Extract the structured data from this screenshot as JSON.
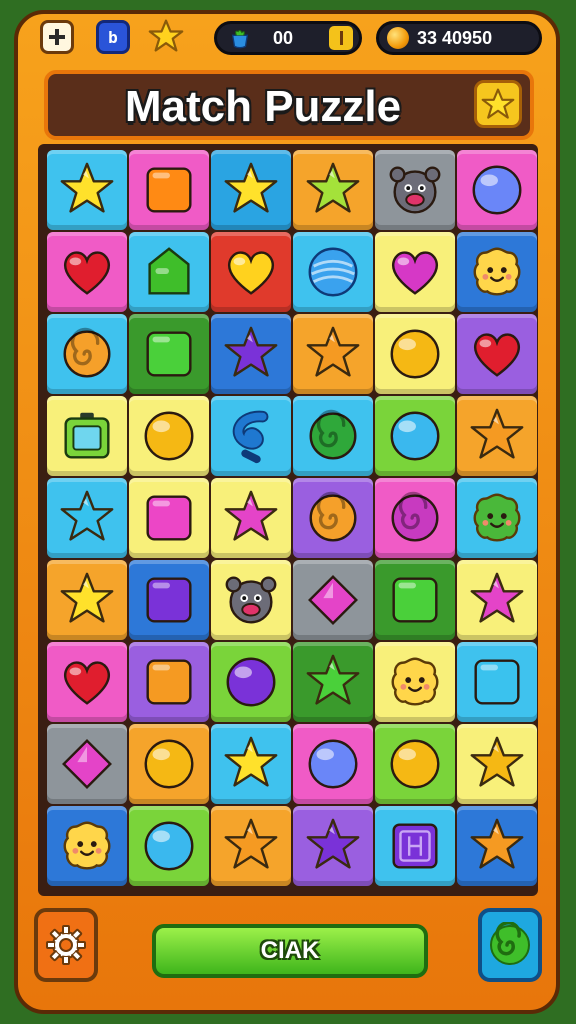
{
  "header": {
    "moves_value": "00",
    "coins_value": "33 40950",
    "blue_button_glyph": "b",
    "icons": [
      "plus-icon",
      "blue-square-icon",
      "star-icon",
      "potion-icon",
      "pause-icon",
      "coin-icon"
    ]
  },
  "title": {
    "text": "Match Puzzle",
    "icon": "star-icon"
  },
  "board": {
    "rows": 9,
    "cols": 6,
    "cells": [
      [
        {
          "bg": "#3fc2ee",
          "piece": "star",
          "color": "#ffe12b"
        },
        {
          "bg": "#f05bc6",
          "piece": "square",
          "color": "#ff8a14"
        },
        {
          "bg": "#2aa4e2",
          "piece": "star",
          "color": "#ffe12b"
        },
        {
          "bg": "#f5a42b",
          "piece": "star",
          "color": "#a4e23a"
        },
        {
          "bg": "#8e959b",
          "piece": "creature",
          "color": "#6c6c78"
        },
        {
          "bg": "#f05bc6",
          "piece": "orb",
          "color": "#6a86f8"
        }
      ],
      [
        {
          "bg": "#f05bc6",
          "piece": "heart",
          "color": "#e01e2e"
        },
        {
          "bg": "#3fc2ee",
          "piece": "gem-house",
          "color": "#3fbe2a"
        },
        {
          "bg": "#e03a2c",
          "piece": "heart",
          "color": "#ffd21e"
        },
        {
          "bg": "#3fc2ee",
          "piece": "swirl-ball",
          "color": "#3aa2ee"
        },
        {
          "bg": "#f8f07a",
          "piece": "heart",
          "color": "#d638c6"
        },
        {
          "bg": "#2d78d8",
          "piece": "blob",
          "color": "#ffd64a"
        }
      ],
      [
        {
          "bg": "#3fc2ee",
          "piece": "spiral",
          "color": "#f5a02a"
        },
        {
          "bg": "#3a9a2c",
          "piece": "square",
          "color": "#4ad03a"
        },
        {
          "bg": "#2d78d8",
          "piece": "star",
          "color": "#7a32d8"
        },
        {
          "bg": "#f5a42b",
          "piece": "star",
          "color": "#f59a22"
        },
        {
          "bg": "#f8f07a",
          "piece": "orb",
          "color": "#f5b814"
        },
        {
          "bg": "#9a5fe0",
          "piece": "heart",
          "color": "#e01e2e"
        }
      ],
      [
        {
          "bg": "#f8f07a",
          "piece": "battery",
          "color": "#7ad43a"
        },
        {
          "bg": "#f8f07a",
          "piece": "orb",
          "color": "#f5b814"
        },
        {
          "bg": "#3fc2ee",
          "piece": "swirl",
          "color": "#1f78d0"
        },
        {
          "bg": "#3fc2ee",
          "piece": "spiral",
          "color": "#2fa83a"
        },
        {
          "bg": "#7ad43a",
          "piece": "orb",
          "color": "#3ab8ee"
        },
        {
          "bg": "#f5a42b",
          "piece": "star",
          "color": "#f59a22"
        }
      ],
      [
        {
          "bg": "#3fc2ee",
          "piece": "star",
          "color": "#36c2ee"
        },
        {
          "bg": "#f8f07a",
          "piece": "square",
          "color": "#ec46c6"
        },
        {
          "bg": "#f8f07a",
          "piece": "star",
          "color": "#e444c8"
        },
        {
          "bg": "#9a5fe0",
          "piece": "spiral",
          "color": "#f5a02a"
        },
        {
          "bg": "#f05bc6",
          "piece": "spiral",
          "color": "#c83ac0"
        },
        {
          "bg": "#3fc2ee",
          "piece": "blob",
          "color": "#4ab83a"
        }
      ],
      [
        {
          "bg": "#f5a42b",
          "piece": "star",
          "color": "#ffe12b"
        },
        {
          "bg": "#2d78d8",
          "piece": "square",
          "color": "#7a32d8"
        },
        {
          "bg": "#f8f07a",
          "piece": "creature",
          "color": "#6c6c78"
        },
        {
          "bg": "#8e959b",
          "piece": "diamond",
          "color": "#e444c8"
        },
        {
          "bg": "#3a9a2c",
          "piece": "square",
          "color": "#4ad03a"
        },
        {
          "bg": "#f8f07a",
          "piece": "star",
          "color": "#e444c8"
        }
      ],
      [
        {
          "bg": "#f05bc6",
          "piece": "heart",
          "color": "#e01e2e"
        },
        {
          "bg": "#9a5fe0",
          "piece": "square",
          "color": "#f59a22"
        },
        {
          "bg": "#7ad43a",
          "piece": "orb",
          "color": "#7a32d8"
        },
        {
          "bg": "#3a9a2c",
          "piece": "star",
          "color": "#4ad03a"
        },
        {
          "bg": "#f8f07a",
          "piece": "blob",
          "color": "#ffd64a"
        },
        {
          "bg": "#3fc2ee",
          "piece": "square",
          "color": "#3ac2ee"
        }
      ],
      [
        {
          "bg": "#8e959b",
          "piece": "diamond",
          "color": "#e444c8"
        },
        {
          "bg": "#f5a42b",
          "piece": "orb",
          "color": "#f5b814"
        },
        {
          "bg": "#3fc2ee",
          "piece": "star",
          "color": "#ffe12b"
        },
        {
          "bg": "#f05bc6",
          "piece": "orb",
          "color": "#6a86f8"
        },
        {
          "bg": "#7ad43a",
          "piece": "orb",
          "color": "#f5b814"
        },
        {
          "bg": "#f8f07a",
          "piece": "star",
          "color": "#f5b814"
        }
      ],
      [
        {
          "bg": "#2d78d8",
          "piece": "blob",
          "color": "#ffd64a"
        },
        {
          "bg": "#7ad43a",
          "piece": "orb",
          "color": "#3ab8ee"
        },
        {
          "bg": "#f5a42b",
          "piece": "star",
          "color": "#f59a22"
        },
        {
          "bg": "#9a5fe0",
          "piece": "star",
          "color": "#7a32d8"
        },
        {
          "bg": "#3fc2ee",
          "piece": "rune-square",
          "color": "#7a32d8"
        },
        {
          "bg": "#2d78d8",
          "piece": "star",
          "color": "#f59a22"
        }
      ]
    ]
  },
  "footer": {
    "action_label": "CIAK",
    "settings_icon": "gear-icon",
    "swirl_icon": "swirl-icon"
  }
}
